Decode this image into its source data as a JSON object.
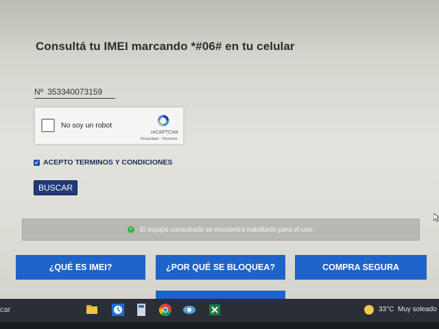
{
  "page": {
    "title": "Consultá tu IMEI marcando *#06# en tu celular"
  },
  "imei": {
    "prefix": "Nº",
    "value": "353340073159"
  },
  "captcha": {
    "label": "No soy un robot",
    "brand": "reCAPTCHA",
    "links": "Privacidad - Términos"
  },
  "terms": {
    "checked": true,
    "label": "ACEPTO TERMINOS Y CONDICIONES"
  },
  "search": {
    "label": "BUSCAR"
  },
  "alert": {
    "message": "El equipo consultado se encuentra habilitado para el uso."
  },
  "nav": {
    "imei": "¿QUÉ ES IMEI?",
    "bloquea": "¿POR QUÉ SE BLOQUEA?",
    "compra": "COMPRA SEGURA"
  },
  "taskbar": {
    "search_fragment": "car",
    "icons": [
      "file-explorer-icon",
      "clock-app-icon",
      "calculator-icon",
      "chrome-icon",
      "network-app-icon",
      "excel-icon"
    ],
    "temperature": "33°C",
    "weather": "Muy soleado"
  },
  "colors": {
    "primary": "#1d63c9",
    "dark_button": "#1e3a7a",
    "success": "#37b24d"
  }
}
